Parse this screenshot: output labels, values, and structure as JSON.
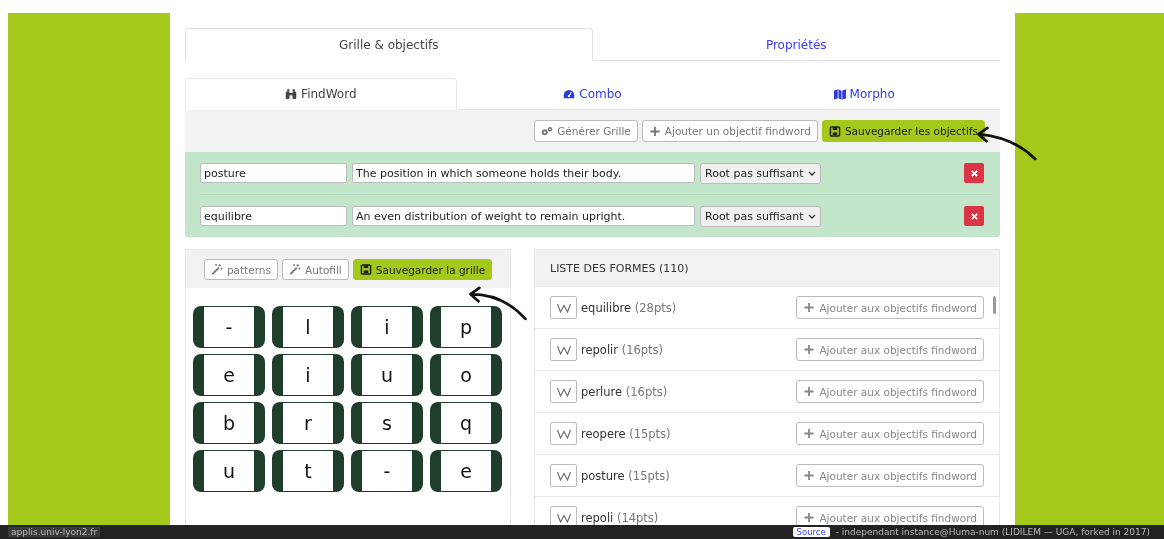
{
  "tabs": [
    {
      "label": "Grille & objectifs",
      "selected": true
    },
    {
      "label": "Propriétés",
      "selected": false
    }
  ],
  "subtabs": [
    {
      "label": "FindWord",
      "selected": true
    },
    {
      "label": "Combo",
      "selected": false
    },
    {
      "label": "Morpho",
      "selected": false
    }
  ],
  "toolbar": [
    {
      "label": "Générer Grille",
      "kind": "gears"
    },
    {
      "label": "Ajouter un objectif findword",
      "kind": "plus"
    },
    {
      "label": "Sauvegarder les objectifs",
      "kind": "save"
    }
  ],
  "objectives": [
    {
      "word": "posture",
      "definition": "The position in which someone holds their body.",
      "mode": "Root pas suffisant"
    },
    {
      "word": "equilibre",
      "definition": "An even distribution of weight to remain upright.",
      "mode": "Root pas suffisant"
    }
  ],
  "grid_toolbar": [
    {
      "label": "patterns",
      "kind": "wand"
    },
    {
      "label": "Autofill",
      "kind": "wand"
    },
    {
      "label": "Sauvegarder la grille",
      "kind": "save"
    }
  ],
  "grid": [
    [
      "-",
      "l",
      "i",
      "p"
    ],
    [
      "e",
      "i",
      "u",
      "o"
    ],
    [
      "b",
      "r",
      "s",
      "q"
    ],
    [
      "u",
      "t",
      "-",
      "e"
    ]
  ],
  "forms": {
    "title": "LISTE DES FORMES (110)",
    "items": [
      {
        "word": "equilibre",
        "points": "(28pts)",
        "add_label": "Ajouter aux objectifs findword"
      },
      {
        "word": "repolir",
        "points": "(16pts)",
        "add_label": "Ajouter aux objectifs findword"
      },
      {
        "word": "perlure",
        "points": "(16pts)",
        "add_label": "Ajouter aux objectifs findword"
      },
      {
        "word": "reopere",
        "points": "(15pts)",
        "add_label": "Ajouter aux objectifs findword"
      },
      {
        "word": "posture",
        "points": "(15pts)",
        "add_label": "Ajouter aux objectifs findword"
      },
      {
        "word": "repoli",
        "points": "(14pts)",
        "add_label": "Ajouter aux objectifs findword"
      }
    ]
  },
  "footer": {
    "left": "applis.univ-lyon2.fr",
    "badge": "Source",
    "text": "- independant instance@Huma-num (LIDILEM — UGA, forked in 2017)"
  }
}
